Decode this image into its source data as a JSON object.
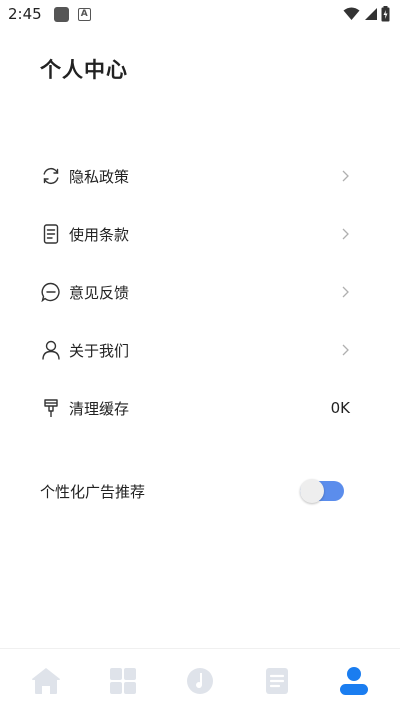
{
  "status_bar": {
    "time": "2:45",
    "icons": [
      "app-icon",
      "a-badge-icon",
      "wifi-icon",
      "signal-icon",
      "battery-icon"
    ]
  },
  "page": {
    "title": "个人中心"
  },
  "menu": {
    "items": [
      {
        "label": "隐私政策",
        "icon": "refresh-icon",
        "has_chevron": true
      },
      {
        "label": "使用条款",
        "icon": "document-icon",
        "has_chevron": true
      },
      {
        "label": "意见反馈",
        "icon": "chat-bubble-icon",
        "has_chevron": true
      },
      {
        "label": "关于我们",
        "icon": "person-icon",
        "has_chevron": true
      },
      {
        "label": "清理缓存",
        "icon": "broom-icon",
        "value": "0K"
      }
    ]
  },
  "toggle_row": {
    "label": "个性化广告推荐",
    "enabled": true
  },
  "bottom_nav": {
    "items": [
      {
        "icon": "home-icon",
        "active": false
      },
      {
        "icon": "grid-icon",
        "active": false
      },
      {
        "icon": "music-icon",
        "active": false
      },
      {
        "icon": "list-icon",
        "active": false
      },
      {
        "icon": "profile-icon",
        "active": true
      }
    ]
  },
  "colors": {
    "accent": "#1a7df0",
    "toggle_track": "#5b8dec",
    "inactive_nav": "#dfe3ea",
    "chevron": "#b0b0b0"
  }
}
